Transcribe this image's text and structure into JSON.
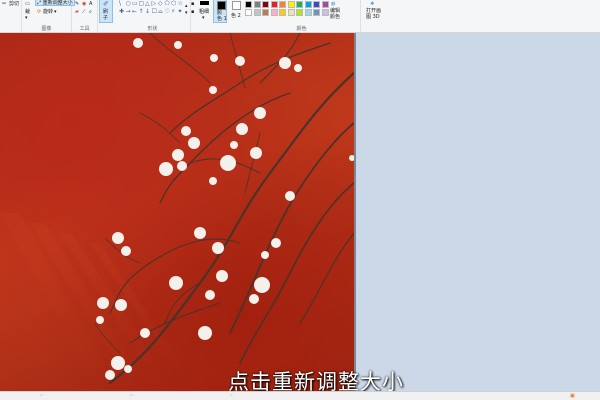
{
  "ribbon": {
    "clipboard": {
      "cut_label": "剪切"
    },
    "image": {
      "resize_label": "重新调整大小",
      "rotate_label": "旋转",
      "crop_label": "裁",
      "group_label": "图像"
    },
    "tools": {
      "group_label": "工具"
    },
    "brush": {
      "label": "刷",
      "sub": "子"
    },
    "shapes": {
      "group_label": "形状",
      "glyphs": [
        "\\",
        "○",
        "▭",
        "▢",
        "△",
        "▷",
        "◇",
        "⬠",
        "⬡",
        "☆",
        "✚",
        "→",
        "←",
        "↑",
        "↓",
        "☐",
        "⌓",
        "♡",
        "⚡",
        "✦"
      ]
    },
    "size": {
      "label": "粗细"
    },
    "color1": {
      "label": "颜",
      "sub": "色 1"
    },
    "color2": {
      "label": "色 2"
    },
    "colors": {
      "group_label": "颜色",
      "palette_row1": [
        "#000000",
        "#7f7f7f",
        "#880015",
        "#ed1c24",
        "#ff7f27",
        "#fff200",
        "#22b14c",
        "#00a2e8",
        "#3f48cc",
        "#a349a4"
      ],
      "palette_row2": [
        "#ffffff",
        "#c3c3c3",
        "#b97a57",
        "#ffaec9",
        "#ffc90e",
        "#efe4b0",
        "#b5e61d",
        "#99d9ea",
        "#7092be",
        "#c8bfe7"
      ],
      "edit_label": "编辑",
      "edit_sub": "颜色"
    },
    "paint3d": {
      "label": "打开画",
      "sub": "图 3D"
    }
  },
  "canvas": {
    "caption": "点击重新调整大小"
  },
  "statusbar": {
    "items": [
      "◦",
      "◦",
      "◦"
    ]
  }
}
